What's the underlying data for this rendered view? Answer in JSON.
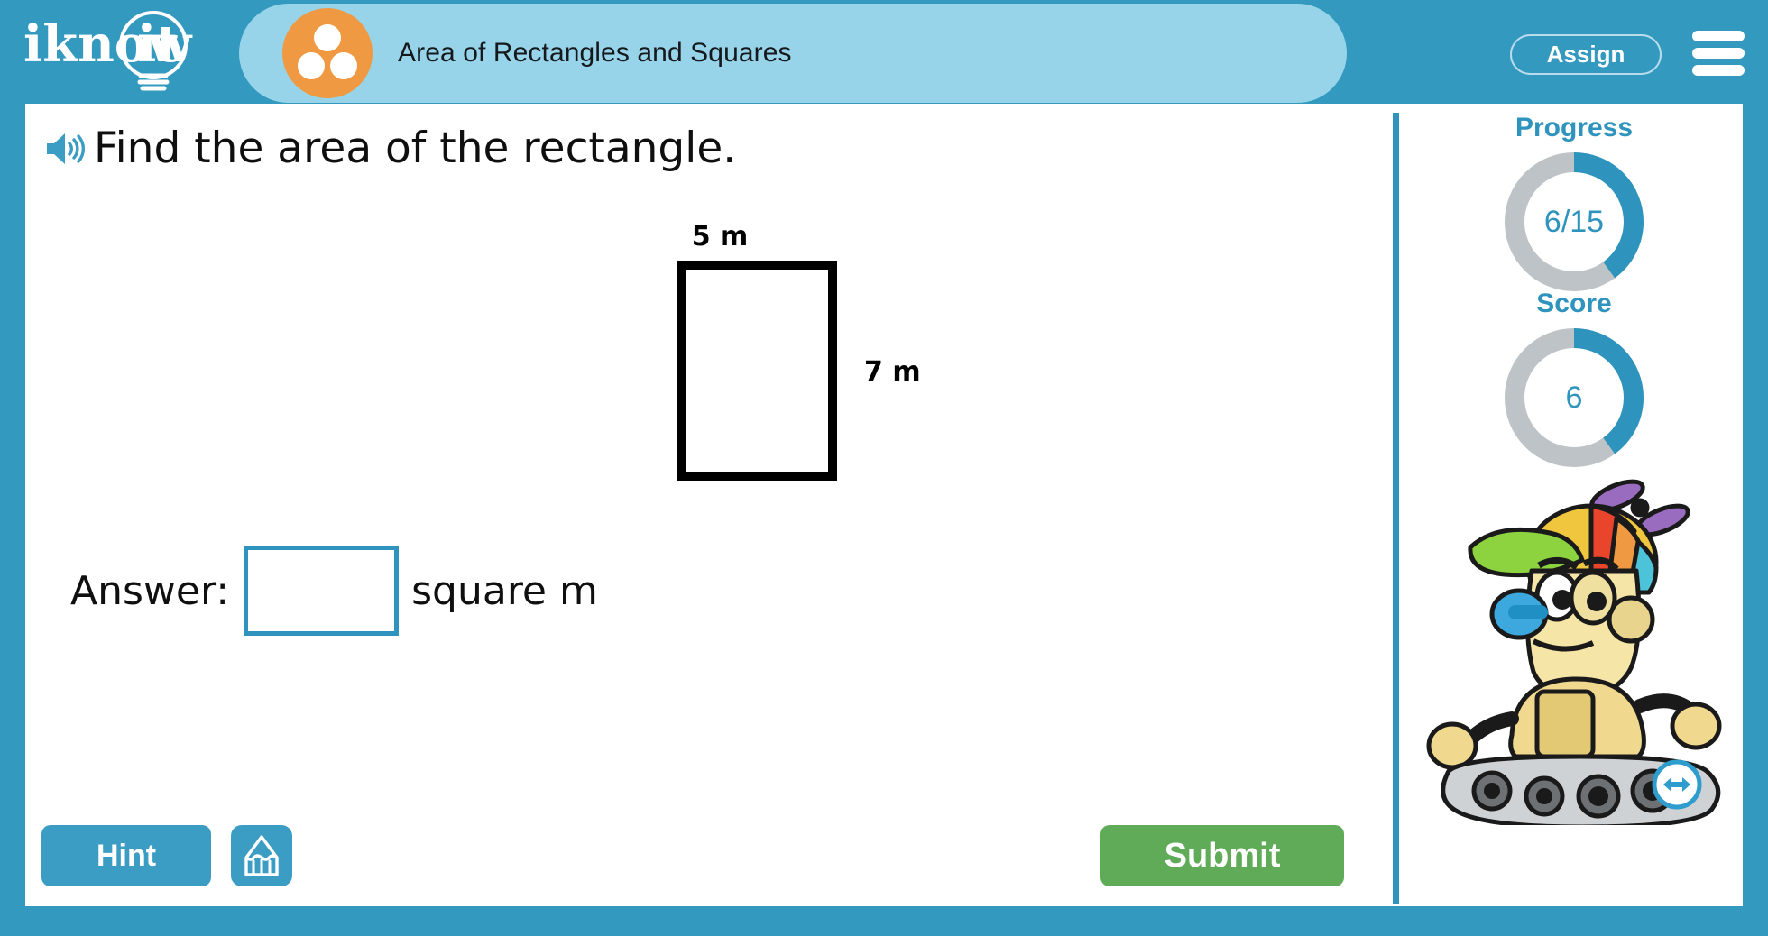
{
  "header": {
    "logo_text": "iknowit",
    "logo_icon": "lightbulb-logo",
    "topic_icon": "three-dots-circle-icon",
    "title": "Area of Rectangles and Squares",
    "assign_label": "Assign",
    "menu_icon": "hamburger-menu-icon",
    "bar_color": "#3399bf",
    "pill_color": "#97d4ea",
    "topic_icon_color": "#ef9a42"
  },
  "question": {
    "audio_icon": "speaker-icon",
    "text": "Find the area of the rectangle."
  },
  "figure": {
    "shape": "rectangle",
    "width_label": "5 m",
    "height_label": "7 m",
    "stroke_color": "#000000",
    "fill_color": "#ffffff"
  },
  "answer": {
    "label": "Answer:",
    "value": "",
    "placeholder": "",
    "unit": "square m",
    "border_color": "#2e94bd"
  },
  "actions": {
    "hint_label": "Hint",
    "scratchpad_icon": "pencil-icon",
    "submit_label": "Submit",
    "hint_color": "#3b9cc4",
    "submit_color": "#5fab58"
  },
  "sidebar": {
    "progress": {
      "label": "Progress",
      "value": "6/15",
      "current": 6,
      "total": 15,
      "arc_color": "#2e94bd",
      "track_color": "#bdc3c7"
    },
    "score": {
      "label": "Score",
      "value": "6",
      "current": 6,
      "total": 15,
      "arc_color": "#2e94bd",
      "track_color": "#bdc3c7"
    },
    "mascot_icon": "robot-mascot",
    "resize_icon": "left-right-arrow-icon"
  }
}
